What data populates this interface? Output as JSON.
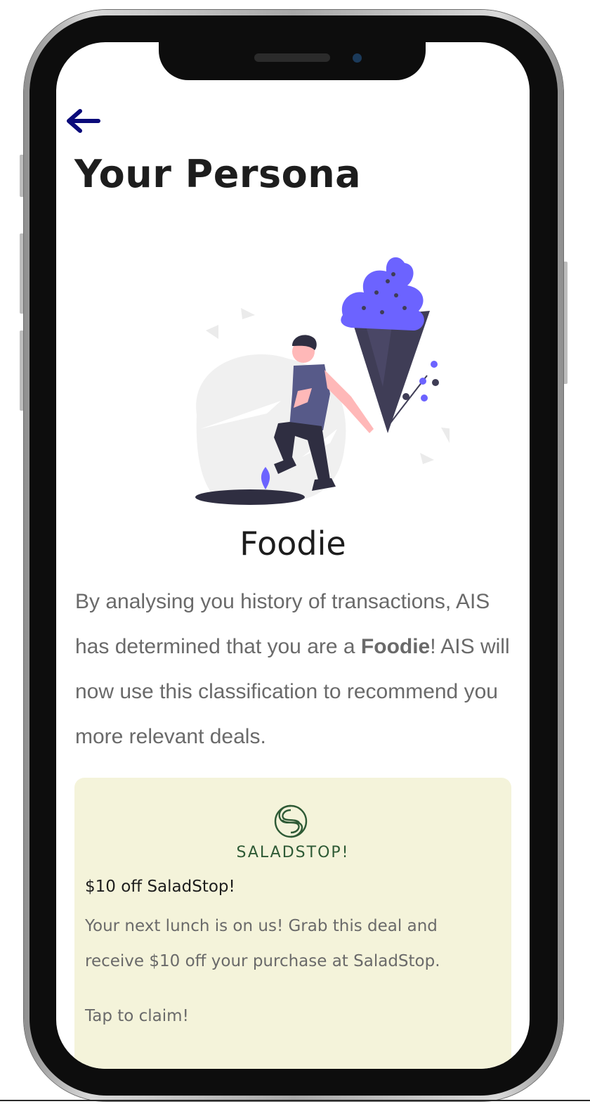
{
  "header": {
    "back_icon": "arrow-left-icon",
    "title": "Your Persona"
  },
  "persona": {
    "name": "Foodie",
    "description_parts": {
      "before": "By analysing you history of transactions, AIS has determined that you are a ",
      "highlight": "Foodie",
      "after": "! AIS will now use this classification to recommend you more relevant deals."
    }
  },
  "deal": {
    "brand_logo_icon": "saladstop-logo-icon",
    "brand_name": "SALADSTOP!",
    "title": "$10 off SaladStop!",
    "description": "Your next lunch is on us! Grab this deal and receive $10 off your purchase at SaladStop.",
    "cta": "Tap to claim!",
    "background_color": "#f4f3da",
    "brand_color": "#2e5a35"
  },
  "colors": {
    "accent": "#6c63ff",
    "back_arrow": "#0b0b7a",
    "title_text": "#1d1d1d",
    "body_text": "#6a6a6a"
  }
}
